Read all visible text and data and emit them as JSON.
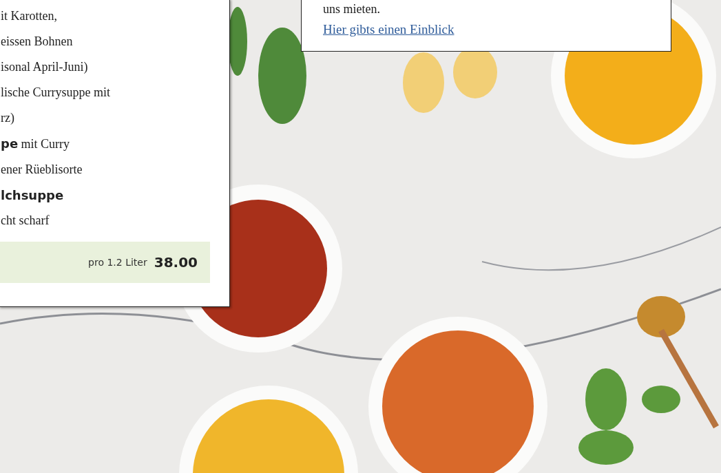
{
  "menu_card": {
    "lines": [
      {
        "text": "it Karotten,",
        "bold": false
      },
      {
        "text": "eissen Bohnen",
        "bold": false
      },
      {
        "text": "isonal April-Juni)",
        "bold": false
      },
      {
        "text": "lische Currysuppe mit",
        "bold": false
      },
      {
        "text": "rz)",
        "bold": false
      },
      {
        "text": "**pe** mit Curry",
        "bold": false
      },
      {
        "text": "ener Rüeblisorte",
        "bold": false
      },
      {
        "text": "lchsuppe",
        "bold": true
      },
      {
        "text": "cht scharf",
        "bold": false
      }
    ],
    "price_unit": "pro 1.2 Liter",
    "price": "38.00"
  },
  "info_card": {
    "text": "uns mieten.",
    "link": "Hier gibts einen Einblick"
  }
}
